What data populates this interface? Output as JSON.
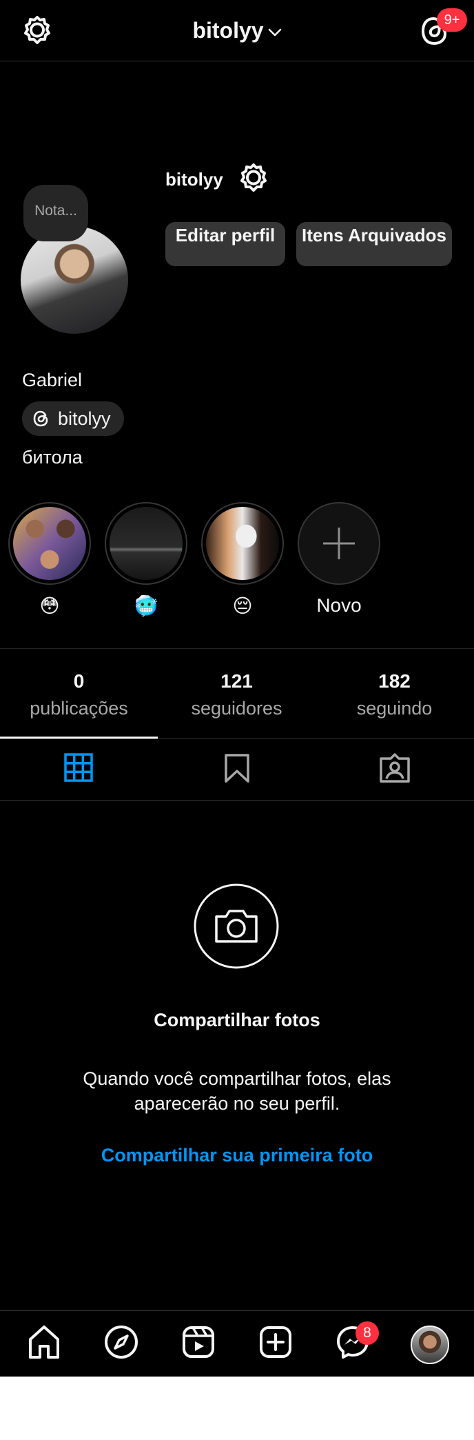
{
  "header": {
    "username": "bitolyy",
    "notification_count": "9+"
  },
  "profile": {
    "username": "bitolyy",
    "note_placeholder": "Nota...",
    "edit_profile_label": "Editar perfil",
    "archive_label": "Itens Arquivados",
    "display_name": "Gabriel",
    "threads_handle": "bitolyy",
    "bio": "битола"
  },
  "highlights": [
    {
      "label": "😳"
    },
    {
      "label": "🥶"
    },
    {
      "label": "😔"
    },
    {
      "label": "Novo"
    }
  ],
  "stats": [
    {
      "value": "0",
      "label": "publicações"
    },
    {
      "value": "121",
      "label": "seguidores"
    },
    {
      "value": "182",
      "label": "seguindo"
    }
  ],
  "tabs": [
    "grid-icon",
    "saved-icon",
    "tagged-icon"
  ],
  "empty_state": {
    "title": "Compartilhar fotos",
    "text": "Quando você compartilhar fotos, elas aparecerão no seu perfil.",
    "link": "Compartilhar sua primeira foto"
  },
  "bottom_nav": {
    "messages_badge": "8"
  },
  "colors": {
    "background": "#000000",
    "accent": "#0095f6",
    "badge": "#ff3040",
    "button": "#363636",
    "secondary_text": "#a8a8a8"
  }
}
